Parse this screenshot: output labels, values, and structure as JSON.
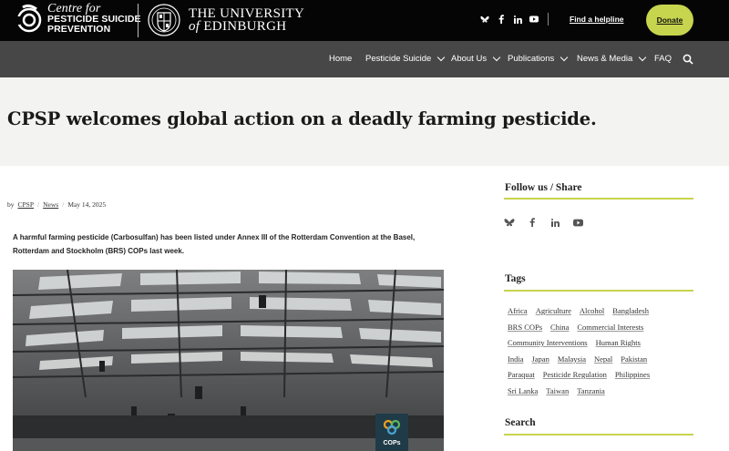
{
  "header": {
    "logo_line1": "Centre for",
    "logo_line2": "PESTICIDE SUICIDE",
    "logo_line3": "PREVENTION",
    "university_line1": "THE UNIVERSITY",
    "university_of": "of",
    "university_line2": "EDINBURGH",
    "helpline_label": "Find a helpline",
    "donate_label": "Donate",
    "social_icons": [
      "bluesky-icon",
      "facebook-icon",
      "linkedin-icon",
      "youtube-icon"
    ]
  },
  "nav": {
    "items": [
      {
        "label": "Home",
        "dropdown": false
      },
      {
        "label": "Pesticide Suicide",
        "dropdown": true
      },
      {
        "label": "About Us",
        "dropdown": true
      },
      {
        "label": "Publications",
        "dropdown": true
      },
      {
        "label": "News & Media",
        "dropdown": true
      },
      {
        "label": "FAQ",
        "dropdown": false
      }
    ],
    "search_icon": "search-icon"
  },
  "article": {
    "title": "CPSP welcomes global action on a deadly farming pesticide.",
    "by": "by",
    "author": "CPSP",
    "category": "News",
    "date": "May 14, 2025",
    "intro_line1": "A harmful farming pesticide (Carbosulfan) has been listed under Annex III of the Rotterdam Convention at the Basel,",
    "intro_line2": "Rotterdam and Stockholm (BRS) COPs last week.",
    "photo_banner_line1": "COPs"
  },
  "sidebar": {
    "follow_heading": "Follow us / Share",
    "tags_heading": "Tags",
    "search_heading": "Search",
    "tags": [
      [
        "Africa",
        "Agriculture",
        "Alcohol",
        "Bangladesh"
      ],
      [
        "BRS COPs",
        "China",
        "Commercial Interests"
      ],
      [
        "Community Interventions",
        "Human Rights"
      ],
      [
        "India",
        "Japan",
        "Malaysia",
        "Nepal",
        "Pakistan"
      ],
      [
        "Paraquat",
        "Pesticide Regulation",
        "Philippines"
      ],
      [
        "Sri Lanka",
        "Taiwan",
        "Tanzania"
      ]
    ]
  },
  "colors": {
    "accent": "#c7d44e",
    "topbar": "#050505",
    "navbar": "#474747",
    "titleband": "#f3f3f1"
  }
}
